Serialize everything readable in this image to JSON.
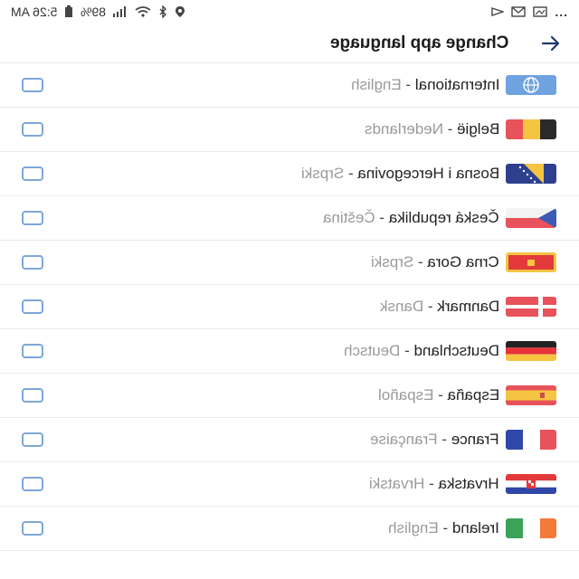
{
  "status_bar": {
    "time": "5:26 AM",
    "battery": "89%",
    "dots": "..."
  },
  "header": {
    "title": "Change app language"
  },
  "rows": [
    {
      "native": "International",
      "english": "English",
      "flag": "globe"
    },
    {
      "native": "België",
      "english": "Nederlands",
      "flag": "be"
    },
    {
      "native": "Bosna i Hercegovina",
      "english": "Srpski",
      "flag": "ba"
    },
    {
      "native": "Česká republika",
      "english": "Čeština",
      "flag": "cz"
    },
    {
      "native": "Crna Gora",
      "english": "Srpski",
      "flag": "me"
    },
    {
      "native": "Danmark",
      "english": "Dansk",
      "flag": "dk"
    },
    {
      "native": "Deutschland",
      "english": "Deutsch",
      "flag": "de"
    },
    {
      "native": "España",
      "english": "Español",
      "flag": "es"
    },
    {
      "native": "France",
      "english": "Française",
      "flag": "fr"
    },
    {
      "native": "Hrvatska",
      "english": "Hrvatski",
      "flag": "hr"
    },
    {
      "native": "Ireland",
      "english": "English",
      "flag": "ie"
    }
  ],
  "separator": " - ",
  "colors": {
    "checkbox_border": "#7da7d9",
    "secondary_text": "#9a9a9a"
  }
}
